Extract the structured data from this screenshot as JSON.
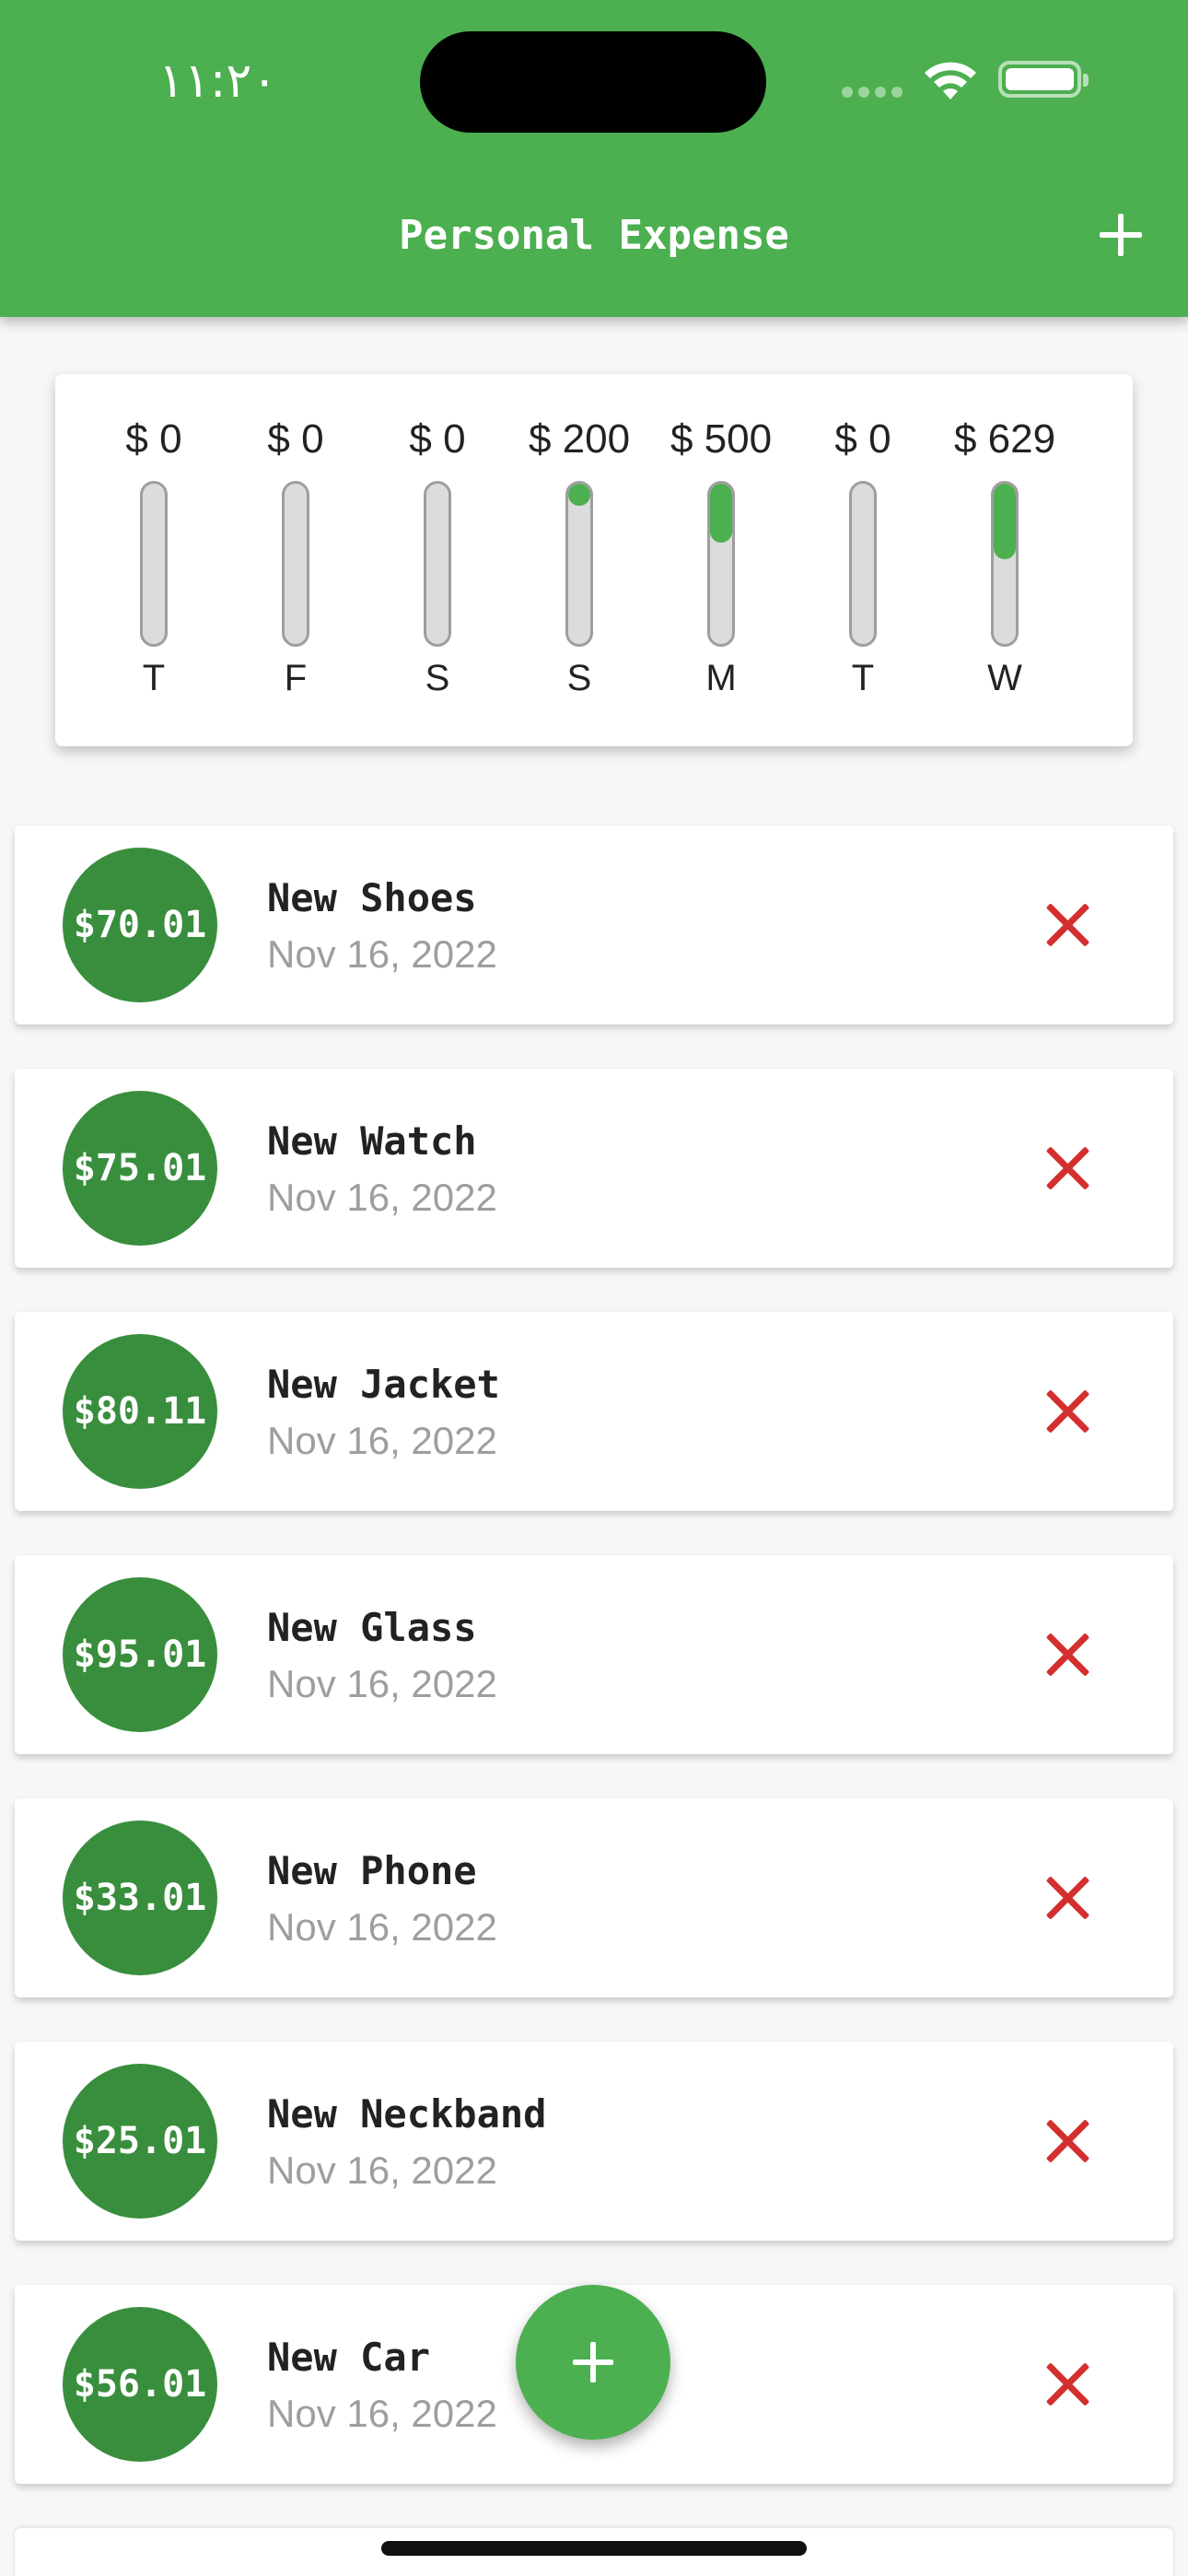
{
  "status_bar": {
    "time": "١١:٢٠"
  },
  "app_bar": {
    "title": "Personal Expense",
    "add_icon": "plus-icon"
  },
  "chart": {
    "bars": [
      {
        "amount": "$ 0",
        "day": "T",
        "fraction": 0.0
      },
      {
        "amount": "$ 0",
        "day": "F",
        "fraction": 0.0
      },
      {
        "amount": "$ 0",
        "day": "S",
        "fraction": 0.0
      },
      {
        "amount": "$ 200",
        "day": "S",
        "fraction": 0.14
      },
      {
        "amount": "$ 500",
        "day": "M",
        "fraction": 0.37
      },
      {
        "amount": "$ 0",
        "day": "T",
        "fraction": 0.0
      },
      {
        "amount": "$ 629",
        "day": "W",
        "fraction": 0.47
      }
    ],
    "fill_color": "#4caf50"
  },
  "transactions": [
    {
      "amount": "$70.01",
      "title": "New Shoes",
      "date": "Nov 16, 2022"
    },
    {
      "amount": "$75.01",
      "title": "New Watch",
      "date": "Nov 16, 2022"
    },
    {
      "amount": "$80.11",
      "title": "New Jacket",
      "date": "Nov 16, 2022"
    },
    {
      "amount": "$95.01",
      "title": "New Glass",
      "date": "Nov 16, 2022"
    },
    {
      "amount": "$33.01",
      "title": "New Phone",
      "date": "Nov 16, 2022"
    },
    {
      "amount": "$25.01",
      "title": "New Neckband",
      "date": "Nov 16, 2022"
    },
    {
      "amount": "$56.01",
      "title": "New Car",
      "date": "Nov 16, 2022"
    }
  ],
  "colors": {
    "primary": "#4caf50",
    "avatar": "#388e3c",
    "delete": "#d32f2f"
  },
  "fab": {
    "icon": "plus-icon"
  }
}
